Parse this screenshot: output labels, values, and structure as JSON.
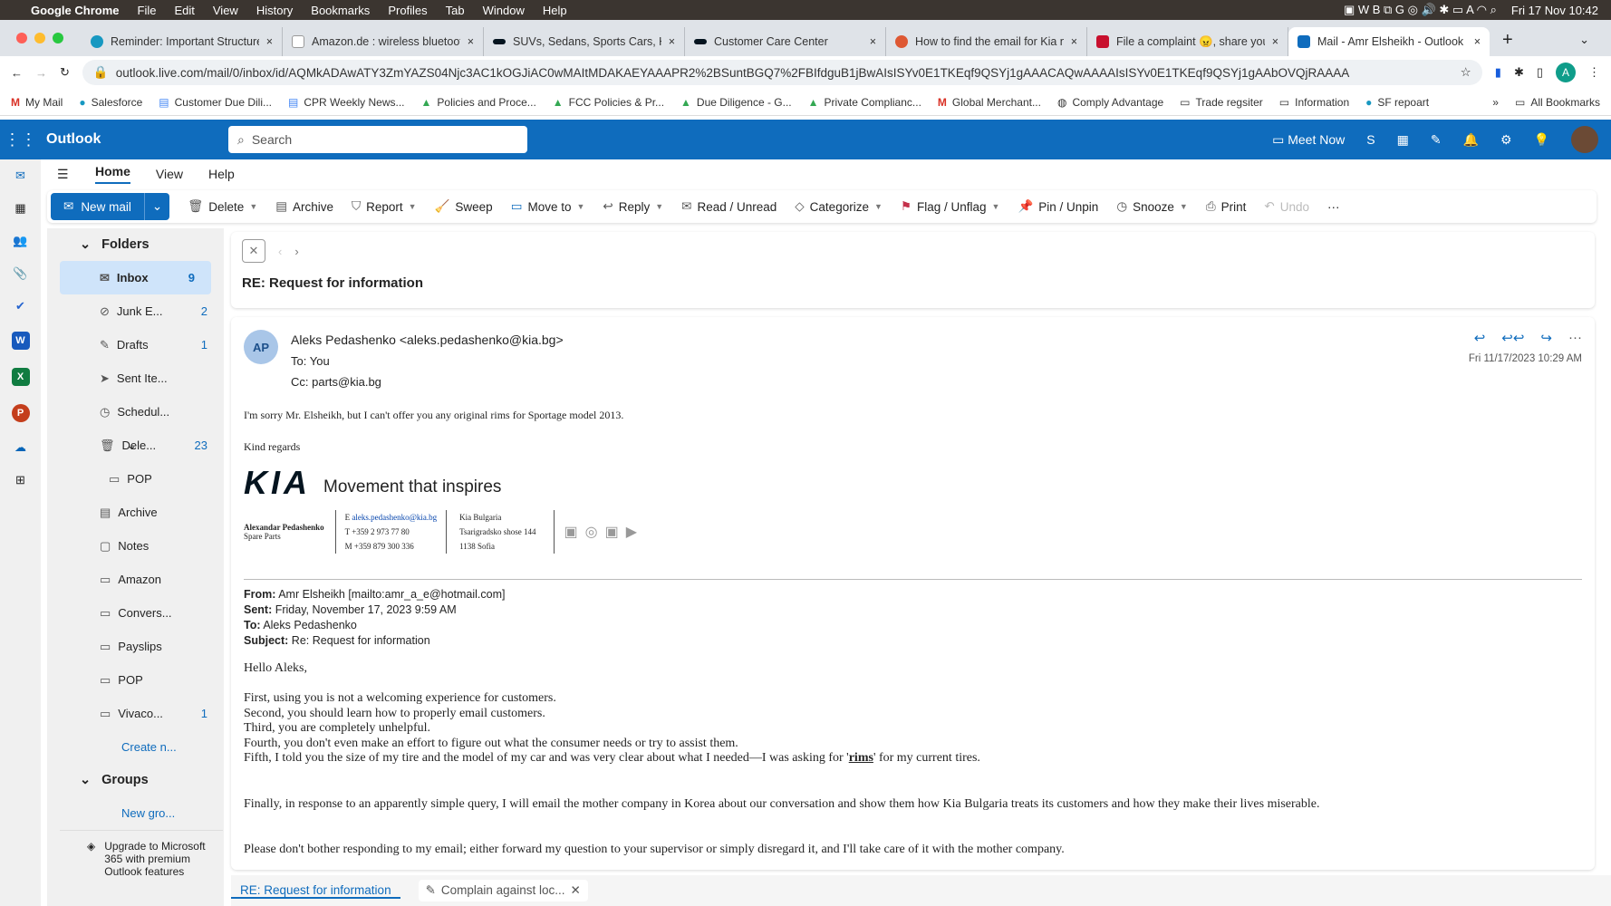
{
  "menubar": {
    "app": "Google Chrome",
    "items": [
      "File",
      "Edit",
      "View",
      "History",
      "Bookmarks",
      "Profiles",
      "Tab",
      "Window",
      "Help"
    ],
    "clock": "Fri 17 Nov  10:42"
  },
  "tabs": [
    {
      "title": "Reminder: Important Structure",
      "color": "#1798c1"
    },
    {
      "title": "Amazon.de : wireless bluetooth",
      "color": "#222"
    },
    {
      "title": "SUVs, Sedans, Sports Cars, H",
      "color": "#05141f"
    },
    {
      "title": "Customer Care Center",
      "color": "#05141f"
    },
    {
      "title": "How to find the email for Kia n",
      "color": "#de5833"
    },
    {
      "title": "File a complaint 😠, share you",
      "color": "#c8102e"
    },
    {
      "title": "Mail - Amr Elsheikh - Outlook",
      "color": "#0f6cbd"
    }
  ],
  "address": {
    "url": "outlook.live.com/mail/0/inbox/id/AQMkADAwATY3ZmYAZS04Njc3AC1kOGJiAC0wMAItMDAKAEYAAAPR2%2BSuntBGQ7%2FBIfdguB1jBwAIsISYv0E1TKEqf9QSYj1gAAACAQwAAAAIsISYv0E1TKEqf9QSYj1gAAbOVQjRAAAA",
    "profile": "A"
  },
  "bookmarks": [
    "My Mail",
    "Salesforce",
    "Customer Due Dili...",
    "CPR Weekly News...",
    "Policies and Proce...",
    "FCC Policies & Pr...",
    "Due Diligence - G...",
    "Private Complianc...",
    "Global Merchant...",
    "Comply Advantage",
    "Trade regsiter",
    "Information",
    "SF repoart"
  ],
  "all_bookmarks": "All Bookmarks",
  "outlook": {
    "app": "Outlook",
    "search_placeholder": "Search",
    "meet_now": "Meet Now"
  },
  "ribbon_tabs": [
    "Home",
    "View",
    "Help"
  ],
  "toolbar": {
    "new_mail": "New mail",
    "items": [
      "Delete",
      "Archive",
      "Report",
      "Sweep",
      "Move to",
      "Reply",
      "Read / Unread",
      "Categorize",
      "Flag / Unflag",
      "Pin / Unpin",
      "Snooze",
      "Print",
      "Undo"
    ]
  },
  "folders": {
    "header": "Folders",
    "items": [
      {
        "name": "Inbox",
        "count": "9",
        "icon": "✉"
      },
      {
        "name": "Junk E...",
        "count": "2",
        "icon": "⊘"
      },
      {
        "name": "Drafts",
        "count": "1",
        "icon": "✎"
      },
      {
        "name": "Sent Ite...",
        "count": "",
        "icon": "➤"
      },
      {
        "name": "Schedul...",
        "count": "",
        "icon": "◷"
      },
      {
        "name": "Dele...",
        "count": "23",
        "icon": "🗑"
      },
      {
        "name": "POP",
        "count": "",
        "icon": "▭"
      },
      {
        "name": "Archive",
        "count": "",
        "icon": "▤"
      },
      {
        "name": "Notes",
        "count": "",
        "icon": "▢"
      },
      {
        "name": "Amazon",
        "count": "",
        "icon": "▭"
      },
      {
        "name": "Convers...",
        "count": "",
        "icon": "▭"
      },
      {
        "name": "Payslips",
        "count": "",
        "icon": "▭"
      },
      {
        "name": "POP",
        "count": "",
        "icon": "▭"
      },
      {
        "name": "Vivaco...",
        "count": "1",
        "icon": "▭"
      }
    ],
    "create": "Create n...",
    "groups": "Groups",
    "new_group": "New gro...",
    "upgrade": "Upgrade to Microsoft 365 with premium Outlook features"
  },
  "message": {
    "subject": "RE: Request for information",
    "avatar": "AP",
    "from": "Aleks Pedashenko <aleks.pedashenko@kia.bg>",
    "to_label": "To:",
    "to": "You",
    "cc_label": "Cc:",
    "cc": "parts@kia.bg",
    "date": "Fri 11/17/2023 10:29 AM",
    "body1": "I'm sorry Mr. Elsheikh, but I can't offer you any original rims for Sportage model 2013.",
    "regards": "Kind regards",
    "sig": {
      "logo": "KIA",
      "tagline": "Movement that inspires",
      "name": "Alexandar Pedashenko",
      "role": "Spare Parts",
      "email_label": "E",
      "email": "aleks.pedashenko@kia.bg",
      "phone": "T +359 2 973 77 80",
      "mobile": "M +359 879 300 336",
      "company": "Kia Bulgaria",
      "street": "Tsarigradsko shose 144",
      "city": "1138 Sofia"
    },
    "quoted": {
      "from_label": "From:",
      "from": "Amr Elsheikh [mailto:amr_a_e@hotmail.com]",
      "sent_label": "Sent:",
      "sent": "Friday, November 17, 2023 9:59 AM",
      "to_label": "To:",
      "to": "Aleks Pedashenko",
      "subject_label": "Subject:",
      "subject": "Re: Request for information",
      "greeting": "Hello Aleks,",
      "lines": [
        "First, using you is not a welcoming experience for customers.",
        "Second, you should learn how to properly email customers.",
        "Third, you are completely unhelpful.",
        "Fourth, you don't even make an effort to figure out what the consumer needs or try to assist them."
      ],
      "line5a": "Fifth, I told you the size of my tire and the model of my car and was very clear about what I needed—I was asking for '",
      "line5b": "rims",
      "line5c": "' for my current tires.",
      "p2": "Finally, in response to an apparently simple query, I will email the mother company in Korea about our conversation and show them how Kia Bulgaria treats its customers and how they make their lives miserable.",
      "p3": "Please don't bother responding to my email; either forward my question to your supervisor or simply disregard it, and I'll take care of it with the mother company."
    }
  },
  "bottom_tabs": [
    "RE: Request for information",
    "Complain against loc..."
  ]
}
